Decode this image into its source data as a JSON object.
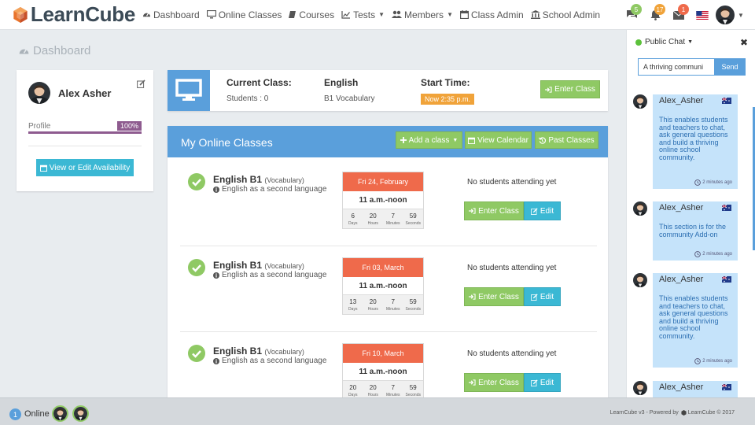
{
  "brand": {
    "name": "LearnCube"
  },
  "nav": {
    "items": [
      "Dashboard",
      "Online Classes",
      "Courses",
      "Tests",
      "Members",
      "Class Admin",
      "School Admin"
    ]
  },
  "notifications": {
    "chat": "5",
    "alerts": "17",
    "messages": "1"
  },
  "page": {
    "title": "Dashboard"
  },
  "profile": {
    "name": "Alex Asher",
    "label": "Profile",
    "percent": "100%",
    "progress_fraction": 1.0,
    "availability_button": "View or Edit Availability"
  },
  "current_class": {
    "label": "Current Class:",
    "students": "Students : 0",
    "subject": "English",
    "level": "B1 Vocabulary",
    "start_label": "Start Time:",
    "start_value": "Now 2:35 p.m.",
    "enter_button": "Enter Class"
  },
  "online_classes": {
    "title": "My Online Classes",
    "add_button": "Add a class",
    "calendar_button": "View Calendar",
    "past_button": "Past Classes",
    "classes": [
      {
        "title": "English B1",
        "tag": "(Vocabulary)",
        "subtitle": "English as a second language",
        "date": "Fri 24, February",
        "time": "11 a.m.-noon",
        "countdown": [
          "6",
          "20",
          "7",
          "59"
        ],
        "status": "No students attending yet",
        "enter": "Enter Class",
        "edit": "Edit"
      },
      {
        "title": "English B1",
        "tag": "(Vocabulary)",
        "subtitle": "English as a second language",
        "date": "Fri 03, March",
        "time": "11 a.m.-noon",
        "countdown": [
          "13",
          "20",
          "7",
          "59"
        ],
        "status": "No students attending yet",
        "enter": "Enter Class",
        "edit": "Edit"
      },
      {
        "title": "English B1",
        "tag": "(Vocabulary)",
        "subtitle": "English as a second language",
        "date": "Fri 10, March",
        "time": "11 a.m.-noon",
        "countdown": [
          "20",
          "20",
          "7",
          "59"
        ],
        "status": "No students attending yet",
        "enter": "Enter Class",
        "edit": "Edit"
      }
    ],
    "countdown_labels": [
      "Days",
      "Hours",
      "Minutes",
      "Seconds"
    ]
  },
  "chat": {
    "title": "Public Chat",
    "input_value": "A thriving communi",
    "send": "Send",
    "messages": [
      {
        "name": "Alex_Asher",
        "text": "This enables students and teachers to chat, ask general questions and build a thriving online school community.",
        "time": "2 minutes ago"
      },
      {
        "name": "Alex_Asher",
        "text": "This section is for the community Add-on",
        "time": "2 minutes ago"
      },
      {
        "name": "Alex_Asher",
        "text": "This enables students and teachers to chat, ask general questions and build a thriving online school community.",
        "time": "2 minutes ago"
      },
      {
        "name": "Alex_Asher",
        "text": "",
        "time": ""
      }
    ]
  },
  "footer": {
    "online_count": "1",
    "online_label": "Online",
    "powered": "LearnCube v3 - Powered by",
    "powered_brand": "LearnCube © 2017"
  },
  "colors": {
    "primary": "#5a9fdb",
    "success": "#8fc964",
    "info": "#3bb8d4",
    "danger": "#ef6a4b",
    "warning": "#f0a33a",
    "purple": "#8e5b8f"
  }
}
